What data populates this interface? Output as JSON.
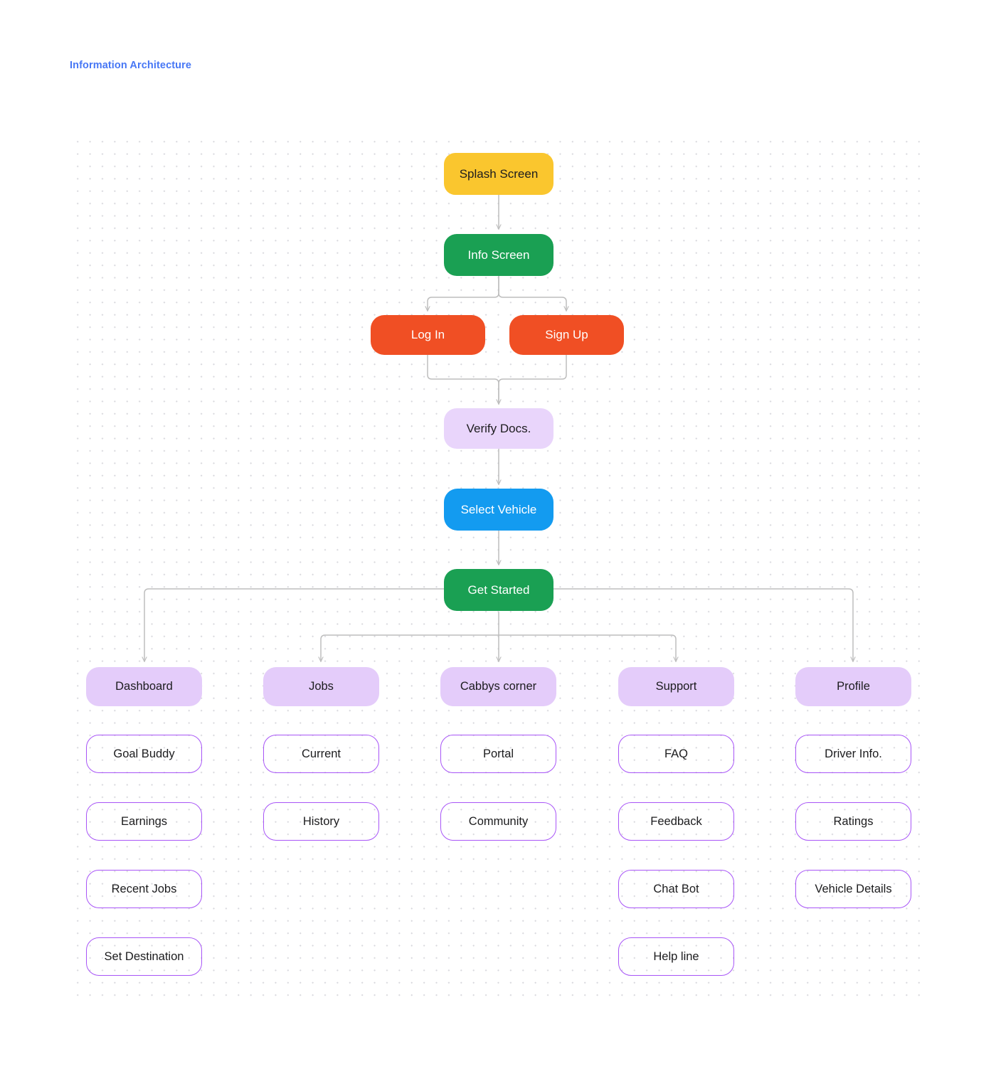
{
  "page": {
    "title": "Information Architecture",
    "title_color": "#4777f5",
    "background": "#ffffff"
  },
  "palette": {
    "splash": "#fac62e",
    "green": "#1aa053",
    "orange": "#f04f24",
    "lilac": "#e9d5fb",
    "blue": "#139bf0",
    "category": "#e4ccfa",
    "leaf_border": "#a855f7",
    "connector": "#bdbdbd",
    "grid_dot": "#d8d8dd",
    "text_dark": "#1c1c1e",
    "text_light": "#ffffff"
  },
  "flow": {
    "splash_screen": "Splash Screen",
    "info_screen": "Info Screen",
    "log_in": "Log In",
    "sign_up": "Sign Up",
    "verify_docs": "Verify Docs.",
    "select_vehicle": "Select Vehicle",
    "get_started": "Get Started"
  },
  "columns": [
    {
      "category": "Dashboard",
      "children": [
        "Goal Buddy",
        "Earnings",
        "Recent Jobs",
        "Set Destination"
      ]
    },
    {
      "category": "Jobs",
      "children": [
        "Current",
        "History"
      ]
    },
    {
      "category": "Cabbys corner",
      "children": [
        "Portal",
        "Community"
      ]
    },
    {
      "category": "Support",
      "children": [
        "FAQ",
        "Feedback",
        "Chat Bot",
        "Help line"
      ]
    },
    {
      "category": "Profile",
      "children": [
        "Driver Info.",
        "Ratings",
        "Vehicle Details"
      ]
    }
  ]
}
